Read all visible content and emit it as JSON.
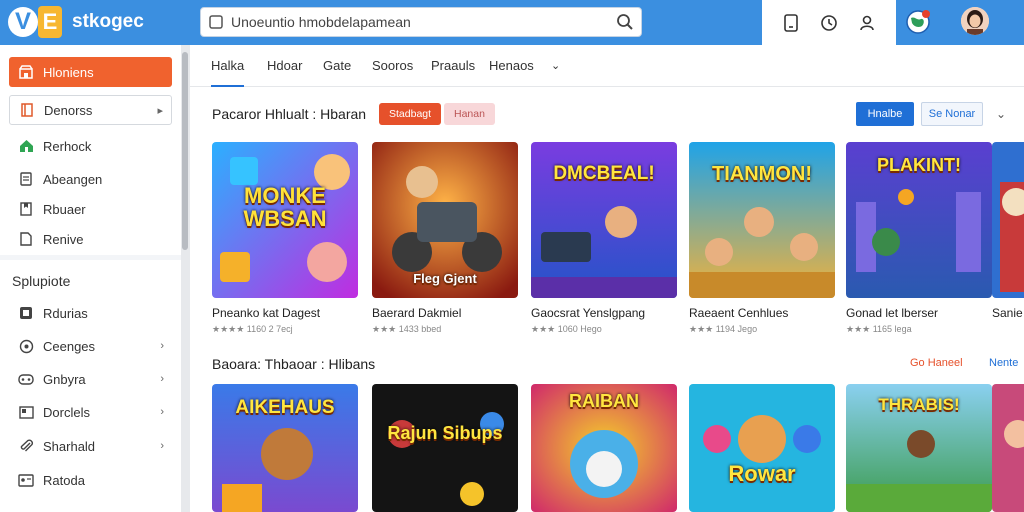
{
  "app": {
    "name": "stkogec"
  },
  "search": {
    "value": "Unoeuntio hmobdelapamean"
  },
  "sidebar": {
    "items": [
      {
        "label": "Hloniens",
        "icon": "storefront-icon"
      },
      {
        "label": "Denorss",
        "icon": "book-icon"
      },
      {
        "label": "Rerhock",
        "icon": "home-icon"
      },
      {
        "label": "Abeangen",
        "icon": "doc-icon"
      },
      {
        "label": "Rbuaer",
        "icon": "bookmark-icon"
      },
      {
        "label": "Renive",
        "icon": "page-icon"
      }
    ],
    "section_title": "Splupiote",
    "section_items": [
      {
        "label": "Rdurias",
        "icon": "tile-icon"
      },
      {
        "label": "Ceenges",
        "icon": "compass-icon"
      },
      {
        "label": "Gnbyra",
        "icon": "controller-icon"
      },
      {
        "label": "Dorclels",
        "icon": "folder-icon"
      },
      {
        "label": "Sharhald",
        "icon": "paperclip-icon"
      },
      {
        "label": "Ratoda",
        "icon": "id-card-icon"
      }
    ]
  },
  "tabs": [
    "Halka",
    "Hdoar",
    "Gate",
    "Sooros",
    "Praauls",
    "Henaos"
  ],
  "featured": {
    "title": "Pacaror Hhlualt : Hbaran",
    "pill_primary": "Stadbagt",
    "pill_secondary": "Hanan",
    "btn_primary": "Hnalbe",
    "btn_secondary": "Se Nonar",
    "cards": [
      {
        "art": "MONKE WBSAN",
        "name": "Pneanko kat Dagest",
        "meta": "★★★★ 1160 2 7ecj"
      },
      {
        "art": "Fleg Gjent",
        "name": "Baerard Dakmiel",
        "meta": "★★★ 1433 bbed"
      },
      {
        "art": "DMCBEAL!",
        "name": "Gaocsrat Yenslgpang",
        "meta": "★★★ 1060 Hego"
      },
      {
        "art": "TIANMON!",
        "name": "Raeaent Cenhlues",
        "meta": "★★★ 1194 Jego"
      },
      {
        "art": "PLAKINT!",
        "name": "Gonad let lberser",
        "meta": "★★★ 1165 lega"
      },
      {
        "art": "",
        "name": "Sanie",
        "meta": ""
      }
    ]
  },
  "second": {
    "title": "Baoara: Thbaoar : Hlibans",
    "link_red": "Go Haneel",
    "link_blue": "Nente",
    "cards": [
      {
        "art": "AIKEHAUS"
      },
      {
        "art": "Rajun Sibups"
      },
      {
        "art": "RAIBAN"
      },
      {
        "art": "Rowar"
      },
      {
        "art": "THRABIS!"
      },
      {
        "art": ""
      }
    ]
  },
  "colors": {
    "topbar": "#3b8fe0",
    "accent": "#f0622e",
    "link": "#1f6fd6"
  }
}
